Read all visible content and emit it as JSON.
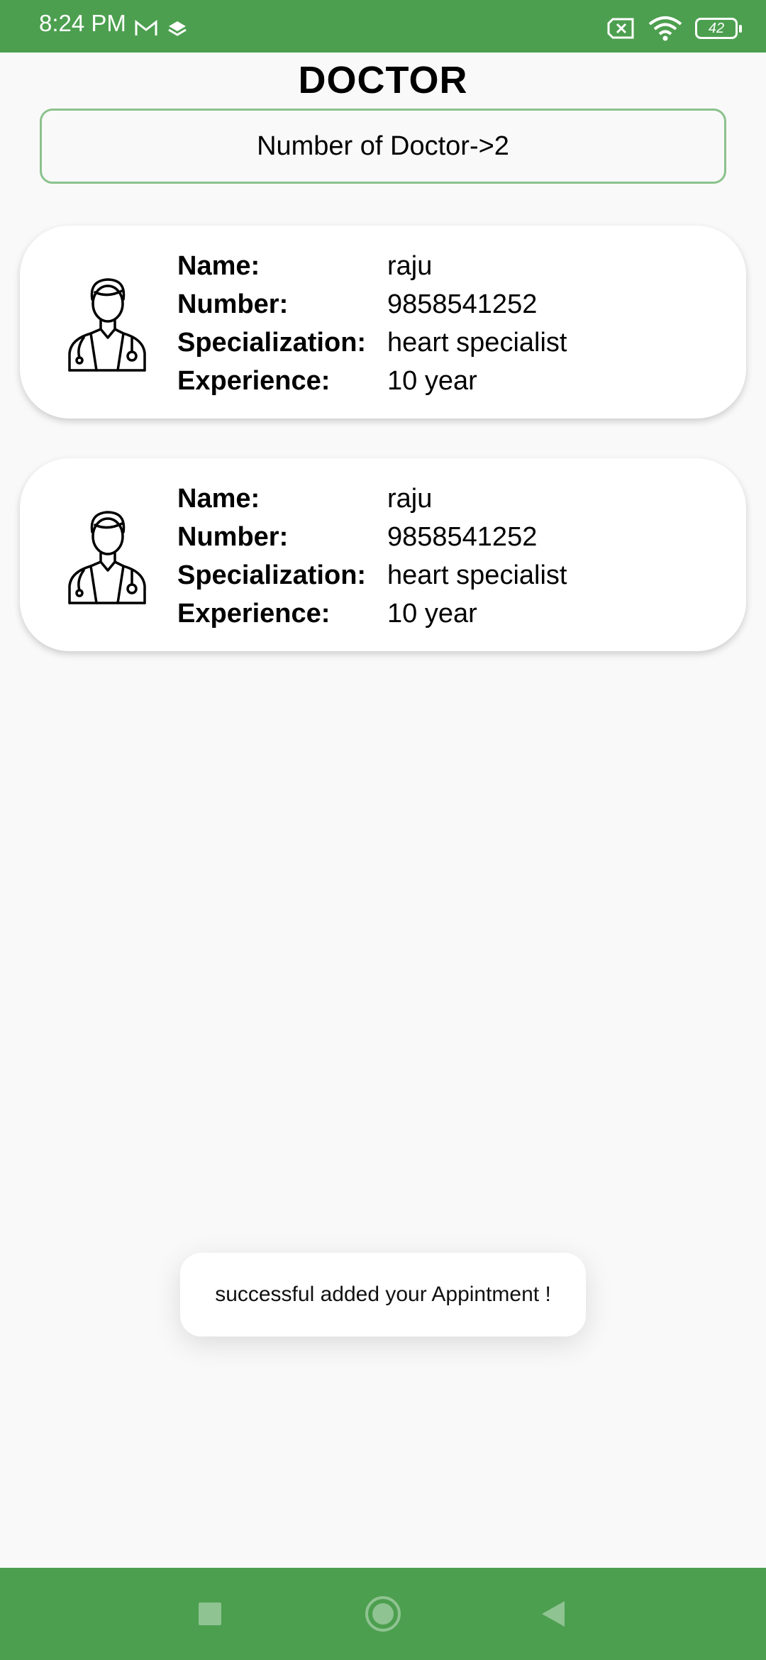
{
  "status_bar": {
    "time": "8:24 PM",
    "left_icons": [
      "gmail-icon",
      "layers-icon"
    ],
    "right_icons": [
      "sim-missing-icon",
      "wifi-icon",
      "battery-icon"
    ],
    "battery_level": "42"
  },
  "header": {
    "title": "DOCTOR",
    "count_text": "Number of Doctor->2"
  },
  "labels": {
    "name": "Name:",
    "number": "Number:",
    "specialization": "Specialization:",
    "experience": "Experience:"
  },
  "doctors": [
    {
      "name": "raju",
      "number": "9858541252",
      "specialization": "heart specialist",
      "experience": "10 year"
    },
    {
      "name": "raju",
      "number": "9858541252",
      "specialization": "heart specialist",
      "experience": "10 year"
    }
  ],
  "toast": {
    "message": "successful added your Appintment !"
  },
  "nav_bar": {
    "buttons": [
      "recents-square-icon",
      "home-circle-icon",
      "back-triangle-icon"
    ]
  },
  "colors": {
    "accent": "#4c9f4f",
    "count_border": "#8bc28c",
    "background": "#f9f9f9"
  }
}
